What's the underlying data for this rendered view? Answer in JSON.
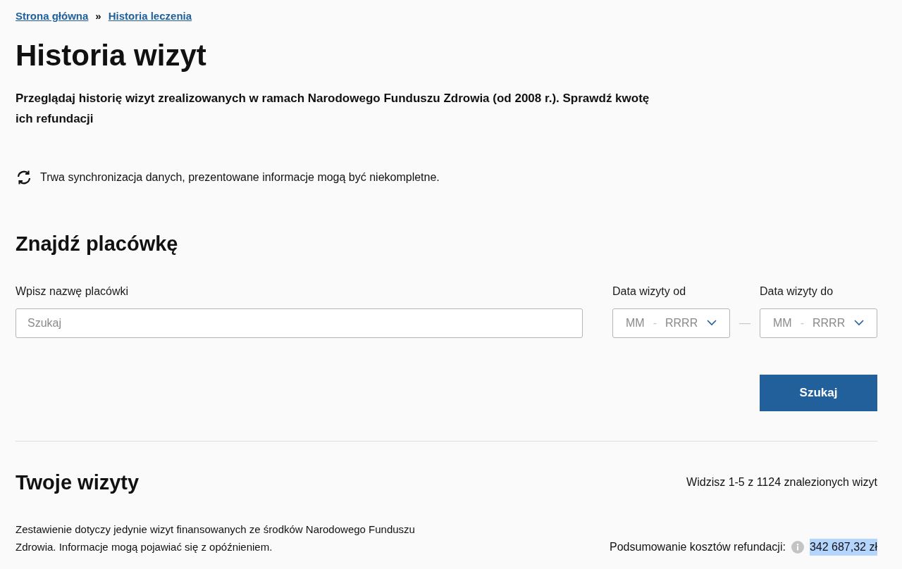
{
  "breadcrumbs": [
    {
      "label": "Strona główna"
    },
    {
      "label": "Historia leczenia"
    }
  ],
  "breadcrumb_separator": "»",
  "title": "Historia wizyt",
  "description": "Przeglądaj historię wizyt zrealizowanych w ramach Narodowego Funduszu Zdrowia (od 2008 r.). Sprawdź kwotę ich refundacji",
  "sync_notice": "Trwa synchronizacja danych, prezentowane informacje mogą być niekompletne.",
  "search_section": {
    "heading": "Znajdź placówkę",
    "name_field": {
      "label": "Wpisz nazwę placówki",
      "placeholder": "Szukaj"
    },
    "date_fields": [
      {
        "label": "Data wizyty od",
        "month_placeholder": "MM",
        "separator": "-",
        "year_placeholder": "RRRR"
      },
      {
        "label": "Data wizyty do",
        "month_placeholder": "MM",
        "separator": "-",
        "year_placeholder": "RRRR"
      }
    ],
    "range_separator": "—",
    "button": "Szukaj"
  },
  "visits_section": {
    "heading": "Twoje wizyty",
    "count": "Widzisz 1-5 z 1124 znalezionych wizyt",
    "note": "Zestawienie dotyczy jedynie wizyt finansowanych ze środków Narodowego Funduszu Zdrowia. Informacje mogą pojawiać się z opóźnieniem.",
    "refund_label": "Podsumowanie kosztów refundacji:",
    "refund_value": "342 687,32 zł",
    "refund_value_highlighted": true
  }
}
